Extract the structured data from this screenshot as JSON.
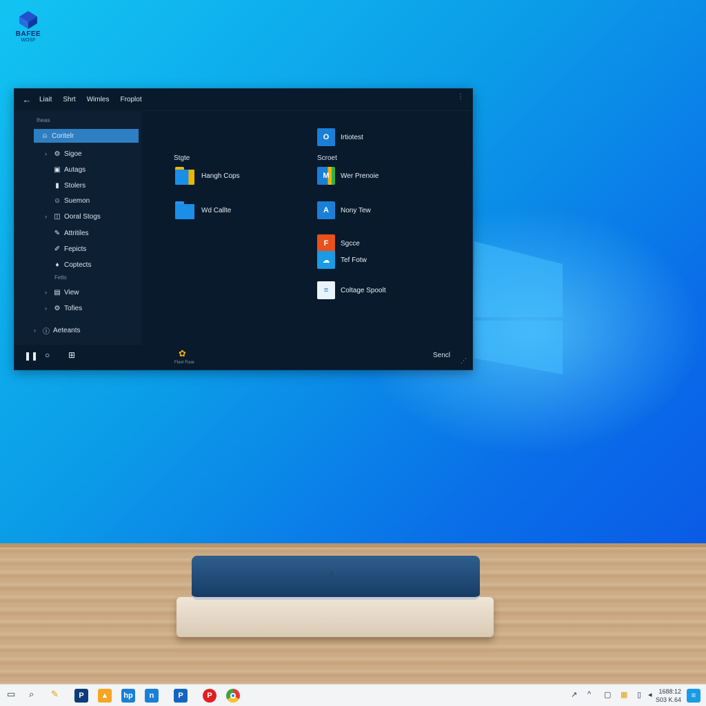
{
  "desktop": {
    "logo": {
      "line1": "BAFEE",
      "line2": "WOSF"
    }
  },
  "window": {
    "menu": [
      "Liait",
      "Shrt",
      "Wimles",
      "Froplot"
    ],
    "sidebar": {
      "section1": "Iheas",
      "items": [
        {
          "label": "Coritelr",
          "icon": "user-icon",
          "active": true,
          "chevron": false
        },
        {
          "label": "Sigoe",
          "icon": "settings-icon",
          "active": false,
          "chevron": true
        },
        {
          "label": "Autags",
          "icon": "image-icon",
          "active": false,
          "chevron": false
        },
        {
          "label": "Stolers",
          "icon": "tag-icon",
          "active": false,
          "chevron": false
        },
        {
          "label": "Suemon",
          "icon": "smile-icon",
          "active": false,
          "chevron": false
        },
        {
          "label": "Ooral Stogs",
          "icon": "shield-icon",
          "active": false,
          "chevron": true
        },
        {
          "label": "Attritiles",
          "icon": "pen-icon",
          "active": false,
          "chevron": false
        },
        {
          "label": "Fepicts",
          "icon": "brush-icon",
          "active": false,
          "chevron": false
        },
        {
          "label": "Coptects",
          "icon": "bulb-icon",
          "active": false,
          "chevron": false
        }
      ],
      "section2": "Fetts",
      "items2": [
        {
          "label": "View",
          "icon": "grid-icon",
          "chevron": true
        },
        {
          "label": "Tofies",
          "icon": "gear-icon",
          "chevron": true
        }
      ],
      "footer_item": {
        "label": "Aeteants",
        "icon": "info-icon",
        "chevron": true
      }
    },
    "content": {
      "col1_header": "Stgte",
      "col2_header": "Scroet",
      "col1_items": [
        {
          "label": "Hangh Cops",
          "icon": "folder-color-icon"
        },
        {
          "label": "Wd Callte",
          "icon": "folder-icon"
        }
      ],
      "top_item": {
        "label": "Irtiotest",
        "icon": "outlook-icon"
      },
      "col2_items": [
        {
          "label": "Wer Prenoie",
          "icon": "app-m-icon"
        },
        {
          "label": "Nony Tew",
          "icon": "app-a-icon"
        },
        {
          "label": "Sgcce",
          "icon": "office-icon"
        },
        {
          "label": "Tef Fotw",
          "icon": "onedrive-icon"
        },
        {
          "label": "Coltage Spoolt",
          "icon": "file-explorer-icon"
        }
      ]
    },
    "bottom": {
      "search_label": "Sencl",
      "center_caption": "Fiuor Fuse"
    }
  },
  "taskbar": {
    "icons": [
      "window-icon",
      "search-icon",
      "pen-icon",
      "p-app-icon",
      "store-icon",
      "hp-app-icon",
      "n-app-icon",
      "p-blue-app-icon",
      "pinterest-icon",
      "chrome-icon"
    ],
    "clock": {
      "time": "1688:12",
      "date": "S03 K.64"
    }
  },
  "colors": {
    "accent": "#2e7fc2",
    "window_bg": "#081a2c",
    "sidebar_bg": "#0d1f33"
  }
}
